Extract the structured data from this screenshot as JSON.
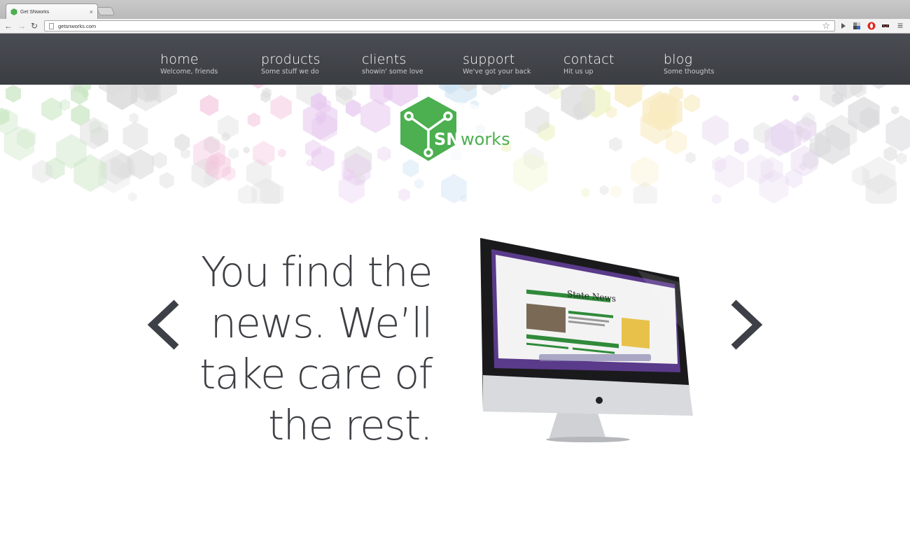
{
  "browser": {
    "tab_title": "Get SNworks",
    "tab_close": "×",
    "url": "getsnworks.com",
    "back": "←",
    "forward": "→",
    "reload": "↻",
    "star": "☆",
    "menu": "≡"
  },
  "nav": {
    "items": [
      {
        "label": "home",
        "sub": "Welcome, friends"
      },
      {
        "label": "products",
        "sub": "Some stuff we do"
      },
      {
        "label": "clients",
        "sub": "showin' some love"
      },
      {
        "label": "support",
        "sub": "We've got your back"
      },
      {
        "label": "contact",
        "sub": "Hit us up"
      },
      {
        "label": "blog",
        "sub": "Some thoughts"
      }
    ]
  },
  "logo": {
    "prefix": "SN",
    "suffix": "works",
    "color": "#4caf50"
  },
  "hero": {
    "headline_lines": [
      "You find the",
      "news. We’ll",
      "take care of",
      "the rest."
    ]
  },
  "colors": {
    "nav_bg": "#42454a",
    "text_dark": "#3d3f44",
    "accent_green": "#4caf50"
  }
}
